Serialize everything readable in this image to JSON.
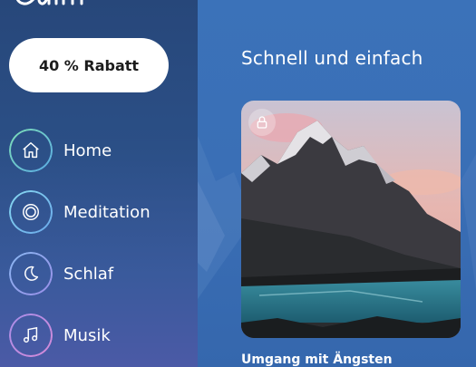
{
  "sidebar": {
    "promo_button": {
      "label": "40 % Rabatt"
    },
    "items": [
      {
        "label": "Home",
        "icon": "home-icon",
        "ring_colors": [
          "#7ee0b5",
          "#5aa9e6"
        ]
      },
      {
        "label": "Meditation",
        "icon": "meditation-circle-icon",
        "ring_colors": [
          "#86d8f0",
          "#6aa8ea"
        ]
      },
      {
        "label": "Schlaf",
        "icon": "moon-icon",
        "ring_colors": [
          "#8ab8f2",
          "#9a8ee8"
        ]
      },
      {
        "label": "Musik",
        "icon": "music-note-icon",
        "ring_colors": [
          "#a78ee8",
          "#d68ad8"
        ]
      }
    ]
  },
  "main": {
    "section_title": "Schnell und einfach",
    "card": {
      "title": "Umgang mit Ängsten",
      "locked": true
    }
  },
  "colors": {
    "sidebar_top": "#27477a",
    "main_bg": "#3b72b9",
    "button_bg": "#ffffff"
  }
}
